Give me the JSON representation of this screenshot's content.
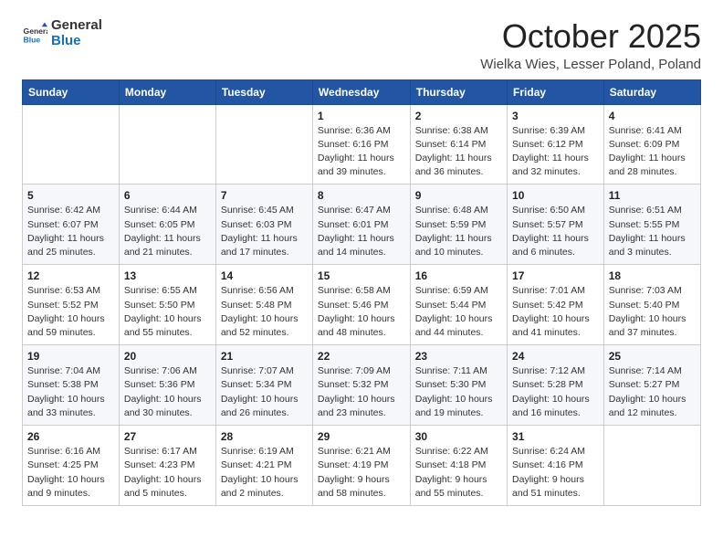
{
  "logo": {
    "text_general": "General",
    "text_blue": "Blue"
  },
  "title": "October 2025",
  "location": "Wielka Wies, Lesser Poland, Poland",
  "days_of_week": [
    "Sunday",
    "Monday",
    "Tuesday",
    "Wednesday",
    "Thursday",
    "Friday",
    "Saturday"
  ],
  "weeks": [
    [
      {
        "day": "",
        "info": ""
      },
      {
        "day": "",
        "info": ""
      },
      {
        "day": "",
        "info": ""
      },
      {
        "day": "1",
        "info": "Sunrise: 6:36 AM\nSunset: 6:16 PM\nDaylight: 11 hours and 39 minutes."
      },
      {
        "day": "2",
        "info": "Sunrise: 6:38 AM\nSunset: 6:14 PM\nDaylight: 11 hours and 36 minutes."
      },
      {
        "day": "3",
        "info": "Sunrise: 6:39 AM\nSunset: 6:12 PM\nDaylight: 11 hours and 32 minutes."
      },
      {
        "day": "4",
        "info": "Sunrise: 6:41 AM\nSunset: 6:09 PM\nDaylight: 11 hours and 28 minutes."
      }
    ],
    [
      {
        "day": "5",
        "info": "Sunrise: 6:42 AM\nSunset: 6:07 PM\nDaylight: 11 hours and 25 minutes."
      },
      {
        "day": "6",
        "info": "Sunrise: 6:44 AM\nSunset: 6:05 PM\nDaylight: 11 hours and 21 minutes."
      },
      {
        "day": "7",
        "info": "Sunrise: 6:45 AM\nSunset: 6:03 PM\nDaylight: 11 hours and 17 minutes."
      },
      {
        "day": "8",
        "info": "Sunrise: 6:47 AM\nSunset: 6:01 PM\nDaylight: 11 hours and 14 minutes."
      },
      {
        "day": "9",
        "info": "Sunrise: 6:48 AM\nSunset: 5:59 PM\nDaylight: 11 hours and 10 minutes."
      },
      {
        "day": "10",
        "info": "Sunrise: 6:50 AM\nSunset: 5:57 PM\nDaylight: 11 hours and 6 minutes."
      },
      {
        "day": "11",
        "info": "Sunrise: 6:51 AM\nSunset: 5:55 PM\nDaylight: 11 hours and 3 minutes."
      }
    ],
    [
      {
        "day": "12",
        "info": "Sunrise: 6:53 AM\nSunset: 5:52 PM\nDaylight: 10 hours and 59 minutes."
      },
      {
        "day": "13",
        "info": "Sunrise: 6:55 AM\nSunset: 5:50 PM\nDaylight: 10 hours and 55 minutes."
      },
      {
        "day": "14",
        "info": "Sunrise: 6:56 AM\nSunset: 5:48 PM\nDaylight: 10 hours and 52 minutes."
      },
      {
        "day": "15",
        "info": "Sunrise: 6:58 AM\nSunset: 5:46 PM\nDaylight: 10 hours and 48 minutes."
      },
      {
        "day": "16",
        "info": "Sunrise: 6:59 AM\nSunset: 5:44 PM\nDaylight: 10 hours and 44 minutes."
      },
      {
        "day": "17",
        "info": "Sunrise: 7:01 AM\nSunset: 5:42 PM\nDaylight: 10 hours and 41 minutes."
      },
      {
        "day": "18",
        "info": "Sunrise: 7:03 AM\nSunset: 5:40 PM\nDaylight: 10 hours and 37 minutes."
      }
    ],
    [
      {
        "day": "19",
        "info": "Sunrise: 7:04 AM\nSunset: 5:38 PM\nDaylight: 10 hours and 33 minutes."
      },
      {
        "day": "20",
        "info": "Sunrise: 7:06 AM\nSunset: 5:36 PM\nDaylight: 10 hours and 30 minutes."
      },
      {
        "day": "21",
        "info": "Sunrise: 7:07 AM\nSunset: 5:34 PM\nDaylight: 10 hours and 26 minutes."
      },
      {
        "day": "22",
        "info": "Sunrise: 7:09 AM\nSunset: 5:32 PM\nDaylight: 10 hours and 23 minutes."
      },
      {
        "day": "23",
        "info": "Sunrise: 7:11 AM\nSunset: 5:30 PM\nDaylight: 10 hours and 19 minutes."
      },
      {
        "day": "24",
        "info": "Sunrise: 7:12 AM\nSunset: 5:28 PM\nDaylight: 10 hours and 16 minutes."
      },
      {
        "day": "25",
        "info": "Sunrise: 7:14 AM\nSunset: 5:27 PM\nDaylight: 10 hours and 12 minutes."
      }
    ],
    [
      {
        "day": "26",
        "info": "Sunrise: 6:16 AM\nSunset: 4:25 PM\nDaylight: 10 hours and 9 minutes."
      },
      {
        "day": "27",
        "info": "Sunrise: 6:17 AM\nSunset: 4:23 PM\nDaylight: 10 hours and 5 minutes."
      },
      {
        "day": "28",
        "info": "Sunrise: 6:19 AM\nSunset: 4:21 PM\nDaylight: 10 hours and 2 minutes."
      },
      {
        "day": "29",
        "info": "Sunrise: 6:21 AM\nSunset: 4:19 PM\nDaylight: 9 hours and 58 minutes."
      },
      {
        "day": "30",
        "info": "Sunrise: 6:22 AM\nSunset: 4:18 PM\nDaylight: 9 hours and 55 minutes."
      },
      {
        "day": "31",
        "info": "Sunrise: 6:24 AM\nSunset: 4:16 PM\nDaylight: 9 hours and 51 minutes."
      },
      {
        "day": "",
        "info": ""
      }
    ]
  ]
}
